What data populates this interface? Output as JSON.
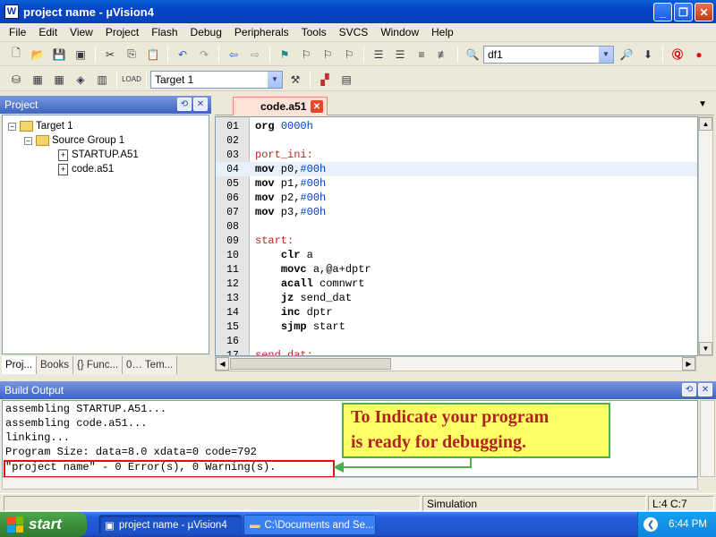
{
  "window": {
    "title": "project name - µVision4",
    "min": "_",
    "max": "❐",
    "close": "✕"
  },
  "menu": [
    "File",
    "Edit",
    "View",
    "Project",
    "Flash",
    "Debug",
    "Peripherals",
    "Tools",
    "SVCS",
    "Window",
    "Help"
  ],
  "toolbar": {
    "find_value": "df1",
    "target_value": "Target 1"
  },
  "project_panel": {
    "title": "Project",
    "tree": {
      "root": "Target 1",
      "group": "Source Group 1",
      "files": [
        "STARTUP.A51",
        "code.a51"
      ]
    },
    "tabs": [
      "Proj...",
      "Books",
      "{} Func...",
      "0… Tem..."
    ]
  },
  "editor": {
    "tab_label": "code.a51",
    "lines": [
      {
        "n": "01",
        "t": "org 0000h"
      },
      {
        "n": "02",
        "t": ""
      },
      {
        "n": "03",
        "t": "port_ini:"
      },
      {
        "n": "04",
        "t": "mov p0,#00h"
      },
      {
        "n": "05",
        "t": "mov p1,#00h"
      },
      {
        "n": "06",
        "t": "mov p2,#00h"
      },
      {
        "n": "07",
        "t": "mov p3,#00h"
      },
      {
        "n": "08",
        "t": ""
      },
      {
        "n": "09",
        "t": "start:"
      },
      {
        "n": "10",
        "t": "    clr a"
      },
      {
        "n": "11",
        "t": "    movc a,@a+dptr"
      },
      {
        "n": "12",
        "t": "    acall comnwrt"
      },
      {
        "n": "13",
        "t": "    jz send_dat"
      },
      {
        "n": "14",
        "t": "    inc dptr"
      },
      {
        "n": "15",
        "t": "    sjmp start"
      },
      {
        "n": "16",
        "t": ""
      },
      {
        "n": "17",
        "t": "send_dat:"
      }
    ]
  },
  "build_output": {
    "title": "Build Output",
    "lines": [
      "assembling STARTUP.A51...",
      "assembling code.a51...",
      "linking...",
      "Program Size: data=8.0 xdata=0 code=792",
      "\"project name\" - 0 Error(s), 0 Warning(s)."
    ]
  },
  "callout": {
    "line1": "To Indicate your program",
    "line2": "is ready for debugging."
  },
  "statusbar": {
    "mode": "Simulation",
    "position": "L:4 C:7"
  },
  "taskbar": {
    "start": "start",
    "tasks": [
      "project name - µVision4",
      "C:\\Documents and Se..."
    ],
    "time": "6:44 PM"
  }
}
